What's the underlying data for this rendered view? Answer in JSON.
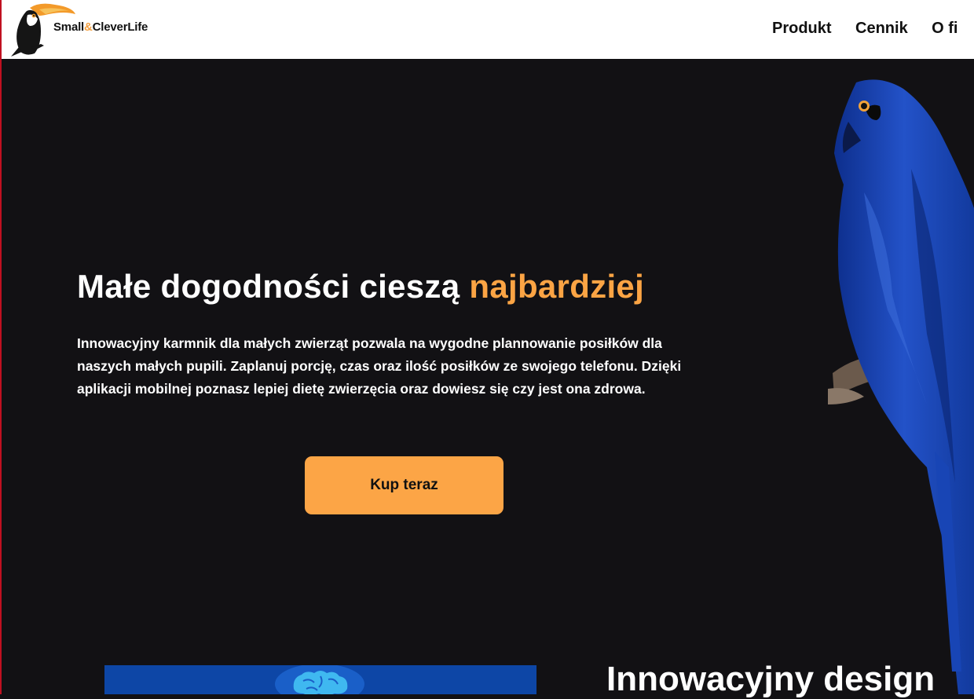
{
  "header": {
    "brand_part1": "Small",
    "brand_amp": "&",
    "brand_part2": "CleverLife",
    "nav": [
      "Produkt",
      "Cennik",
      "O fi"
    ]
  },
  "hero": {
    "headline_main": "Małe dogodności cieszą ",
    "headline_accent": "najbardziej",
    "lead": "Innowacyjny karmnik dla małych zwierząt pozwala na wygodne plannowanie posiłków dla naszych małych pupili. Zaplanuj porcję, czas oraz ilość posiłków ze swojego telefonu. Dzięki aplikacji mobilnej poznasz lepiej dietę zwierzęcia oraz dowiesz się czy jest ona zdrowa.",
    "cta_label": "Kup teraz"
  },
  "features": {
    "title": "Innowacyjny design"
  },
  "icons": {
    "logo": "toucan-logo",
    "hero_image": "blue-macaw-photo",
    "feature_icon": "brain-icon"
  },
  "colors": {
    "accent": "#fba444",
    "background": "#121114",
    "feature_card": "#0d46a6"
  }
}
